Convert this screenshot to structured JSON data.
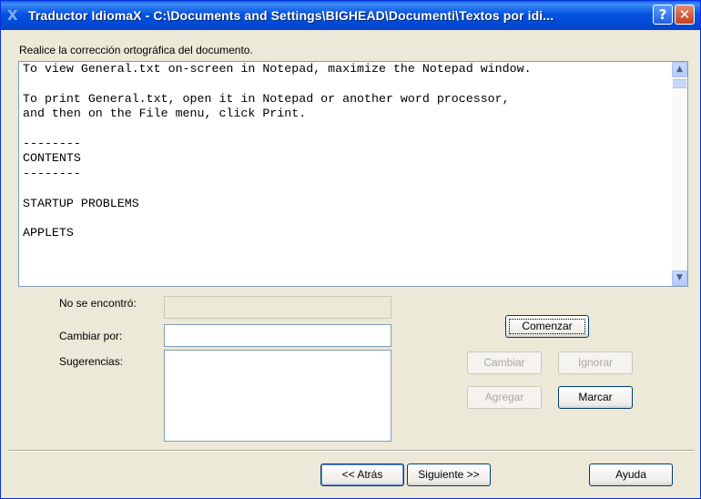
{
  "window": {
    "icon_glyph": "X",
    "title": "Traductor IdiomaX - C:\\Documents and Settings\\BIGHEAD\\Documenti\\Textos por idi...",
    "help_glyph": "?",
    "close_glyph": "✕"
  },
  "spellcheck": {
    "instruction": "Realice la corrección ortográfica del documento.",
    "document_lines": [
      "To view General.txt on-screen in Notepad, maximize the Notepad window.",
      "",
      "To print General.txt, open it in Notepad or another word processor,",
      "and then on the File menu, click Print.",
      "",
      "--------",
      "CONTENTS",
      "--------",
      "",
      "STARTUP PROBLEMS",
      "",
      "APPLETS"
    ],
    "scroll_up_glyph": "▲",
    "scroll_down_glyph": "▼",
    "not_found_label": "No se encontró:",
    "not_found_value": "",
    "change_to_label": "Cambiar por:",
    "change_to_value": "",
    "suggestions_label": "Sugerencias:",
    "suggestions": []
  },
  "buttons": {
    "start": "Comenzar",
    "change": "Cambiar",
    "ignore": "Ignorar",
    "add": "Agregar",
    "mark": "Marcar",
    "back": "<< Atrás",
    "next": "Siguiente >>",
    "help": "Ayuda"
  },
  "colors": {
    "titlebar": "#0554e3",
    "dialog_background": "#ece9d8",
    "disabled_text": "#aca899",
    "field_border": "#7f9db9"
  }
}
